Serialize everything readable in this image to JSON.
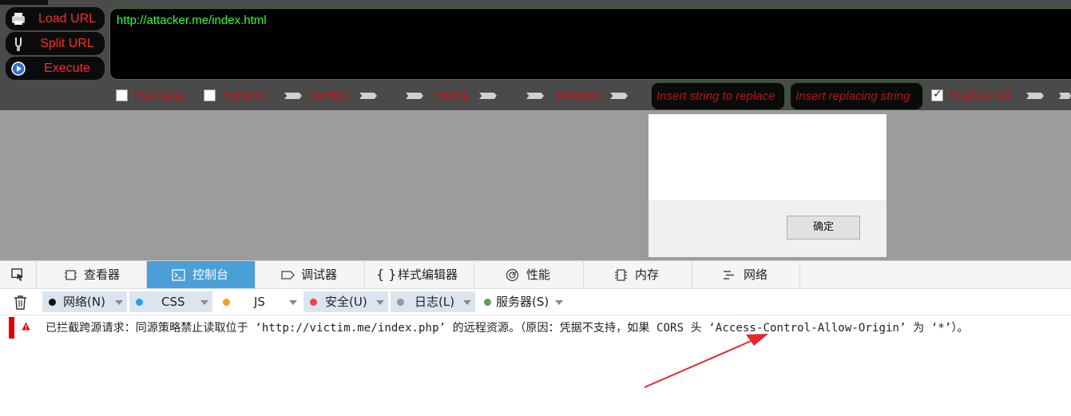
{
  "hackbar": {
    "buttons": {
      "load_url": "Load URL",
      "split_url": "Split URL",
      "execute": "Execute"
    },
    "url": "http://attacker.me/index.html",
    "options": {
      "post_data": "Post data",
      "referrer": "Referrer",
      "hex": "0xHEX",
      "url_encode": "%URL",
      "base64": "BASE64",
      "replace_all": "Replace All"
    },
    "post_data_checked": false,
    "referrer_checked": false,
    "replace_all_checked": true,
    "insert_string_placeholder": "Insert string to replace",
    "insert_replacing_placeholder": "Insert replacing string"
  },
  "dialog": {
    "ok_label": "确定"
  },
  "devtools": {
    "tabs": [
      {
        "label": "查看器",
        "icon": "inspector-icon"
      },
      {
        "label": "控制台",
        "icon": "console-icon",
        "active": true
      },
      {
        "label": "调试器",
        "icon": "debugger-icon"
      },
      {
        "label": "样式编辑器",
        "icon": "braces-icon"
      },
      {
        "label": "性能",
        "icon": "performance-icon"
      },
      {
        "label": "内存",
        "icon": "memory-icon"
      },
      {
        "label": "网络",
        "icon": "network-icon"
      }
    ],
    "filters": [
      {
        "label": "网络(N)",
        "color": "#111111",
        "on": true
      },
      {
        "label": "CSS",
        "color": "#1fa3e6",
        "on": true
      },
      {
        "label": "JS",
        "color": "#f0a020",
        "on": false
      },
      {
        "label": "安全(U)",
        "color": "#e9444e",
        "on": true
      },
      {
        "label": "日志(L)",
        "color": "#9a9a9a",
        "on": true
      },
      {
        "label": "服务器(S)",
        "color": "#5aa05a",
        "on": false
      }
    ],
    "console_message": "已拦截跨源请求：同源策略禁止读取位于 ‘http://victim.me/index.php’ 的远程资源。（原因：凭据不支持，如果 CORS 头 ‘Access-Control-Allow-Origin’ 为 ‘*’）。",
    "error_color": "#e00000"
  }
}
